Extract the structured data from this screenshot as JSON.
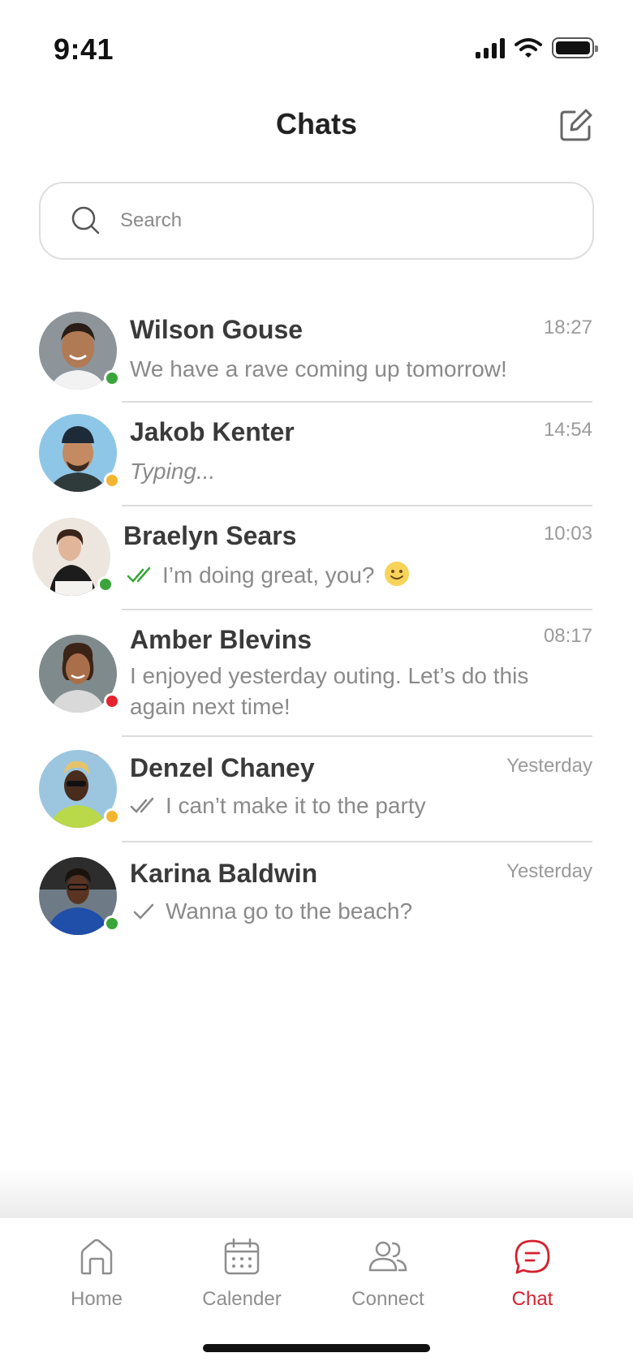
{
  "status_bar": {
    "time": "9:41"
  },
  "header": {
    "title": "Chats"
  },
  "search": {
    "placeholder": "Search"
  },
  "colors": {
    "accent": "#d6202e",
    "online": "#3aa53a",
    "away": "#f2b531",
    "busy": "#e5222f",
    "read_tick": "#3aa53a",
    "sent_tick": "#888888"
  },
  "chats": [
    {
      "name": "Wilson Gouse",
      "time": "18:27",
      "preview": "We have a rave coming up tomorrow!",
      "status": "online",
      "tick": "none",
      "emoji": false,
      "typing": false
    },
    {
      "name": "Jakob Kenter",
      "time": "14:54",
      "preview": "Typing...",
      "status": "away",
      "tick": "none",
      "emoji": false,
      "typing": true
    },
    {
      "name": "Braelyn Sears",
      "time": "10:03",
      "preview": "I’m doing great, you?",
      "status": "online",
      "tick": "double-read",
      "emoji": true,
      "typing": false
    },
    {
      "name": "Amber Blevins",
      "time": "08:17",
      "preview": "I enjoyed yesterday outing. Let’s do this again next time!",
      "status": "busy",
      "tick": "none",
      "emoji": false,
      "typing": false
    },
    {
      "name": "Denzel Chaney",
      "time": "Yesterday",
      "preview": "I can’t make it to the party",
      "status": "away",
      "tick": "double-sent",
      "emoji": false,
      "typing": false
    },
    {
      "name": "Karina Baldwin",
      "time": "Yesterday",
      "preview": "Wanna go to the beach?",
      "status": "online",
      "tick": "single",
      "emoji": false,
      "typing": false
    }
  ],
  "tab_bar": {
    "items": [
      {
        "label": "Home",
        "icon": "home-icon",
        "active": false
      },
      {
        "label": "Calender",
        "icon": "calendar-icon",
        "active": false
      },
      {
        "label": "Connect",
        "icon": "connect-icon",
        "active": false
      },
      {
        "label": "Chat",
        "icon": "chat-icon",
        "active": true
      }
    ]
  }
}
